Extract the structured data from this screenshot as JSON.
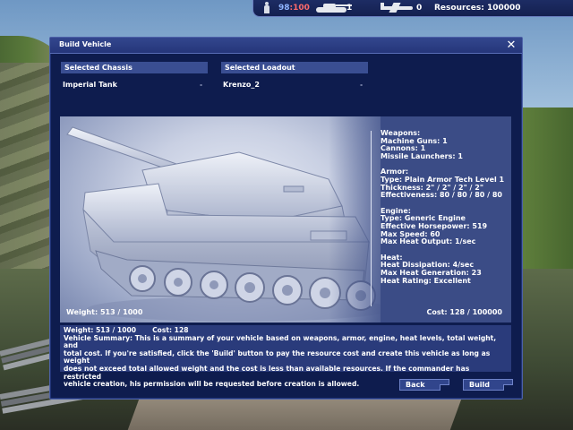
{
  "hud": {
    "units_current": "98",
    "units_sep": ":",
    "units_max": "100",
    "tank_count": "1",
    "plane_count": "0",
    "resources_label": "Resources: 100000"
  },
  "dialog": {
    "title": "Build Vehicle",
    "close_label": "✕",
    "chassis_header": "Selected Chassis",
    "chassis_value": "Imperial Tank",
    "loadout_header": "Selected Loadout",
    "loadout_value": "Krenzo_2",
    "dropdown_arrow": "-",
    "weapons": {
      "title": "Weapons:",
      "machine_guns": "Machine Guns: 1",
      "cannons": "Cannons: 1",
      "missile_launchers": "Missile Launchers: 1"
    },
    "armor": {
      "title": "Armor:",
      "type": "Type: Plain Armor Tech Level 1",
      "thickness": "Thickness: 2\" / 2\" / 2\" / 2\"",
      "effectiveness": "Effectiveness: 80 / 80 / 80 / 80"
    },
    "engine": {
      "title": "Engine:",
      "type": "Type: Generic Engine",
      "horsepower": "Effective Horsepower: 519",
      "max_speed": "Max Speed: 60",
      "max_heat_output": "Max Heat Output: 1/sec"
    },
    "heat": {
      "title": "Heat:",
      "dissipation": "Heat Dissipation: 4/sec",
      "max_generation": "Max Heat Generation: 23",
      "rating": "Heat Rating: Excellent"
    },
    "weight": "Weight: 513 / 1000",
    "cost": "Cost: 128 / 100000",
    "summary": {
      "weight": "Weight: 513 / 1000",
      "cost": "Cost: 128",
      "line2": "Vehicle Summary: This is a summary of your vehicle based on weapons, armor, engine, heat levels, total weight, and",
      "line3": "total cost.  If you're satisfied, click the 'Build' button to pay the resource cost and create this vehicle as long as weight",
      "line4": "does not exceed total allowed weight and the cost is less than available resources.  If the commander has restricted",
      "line5": "vehicle creation, his permission will be requested before creation is allowed."
    },
    "back_label": "Back",
    "build_label": "Build"
  },
  "colors": {
    "dialog_bg": "#0e1c4e",
    "header_bg": "#3a4e92",
    "units_current": "#8fb4ff",
    "units_max": "#ff6b6b"
  },
  "icons": [
    "soldier-icon",
    "tank-icon",
    "plane-icon",
    "close-icon"
  ]
}
